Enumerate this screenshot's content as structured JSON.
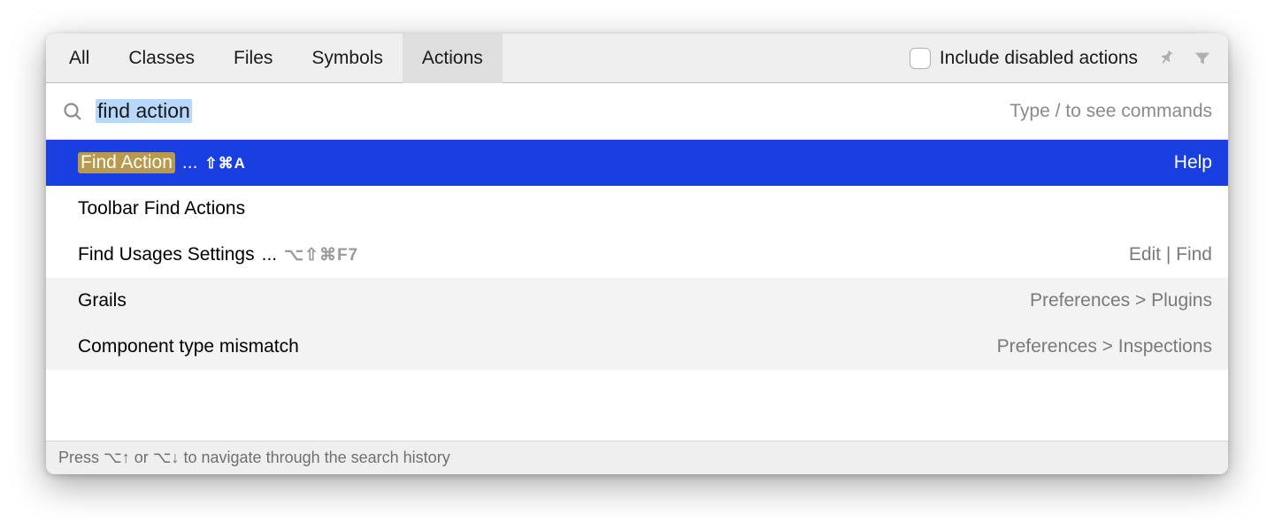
{
  "tabs": {
    "all": "All",
    "classes": "Classes",
    "files": "Files",
    "symbols": "Symbols",
    "actions": "Actions"
  },
  "toolbar": {
    "include_disabled_label": "Include disabled actions"
  },
  "search": {
    "query": "find action",
    "hint": "Type / to see commands"
  },
  "results": [
    {
      "label": "Find Action",
      "ellipsis": "...",
      "shortcut": "⇧⌘A",
      "category": "Help",
      "highlight": true,
      "selected": true
    },
    {
      "label": "Toolbar Find Actions",
      "ellipsis": "",
      "shortcut": "",
      "category": "",
      "highlight": false,
      "selected": false
    },
    {
      "label": "Find Usages Settings",
      "ellipsis": "...",
      "shortcut": "⌥⇧⌘F7",
      "category": "Edit | Find",
      "highlight": false,
      "selected": false
    },
    {
      "label": "Grails",
      "ellipsis": "",
      "shortcut": "",
      "category": "Preferences > Plugins",
      "highlight": false,
      "selected": false,
      "alt": true
    },
    {
      "label": "Component type mismatch",
      "ellipsis": "",
      "shortcut": "",
      "category": "Preferences > Inspections",
      "highlight": false,
      "selected": false,
      "alt": true
    }
  ],
  "footer": {
    "hint": "Press ⌥↑ or ⌥↓ to navigate through the search history"
  }
}
